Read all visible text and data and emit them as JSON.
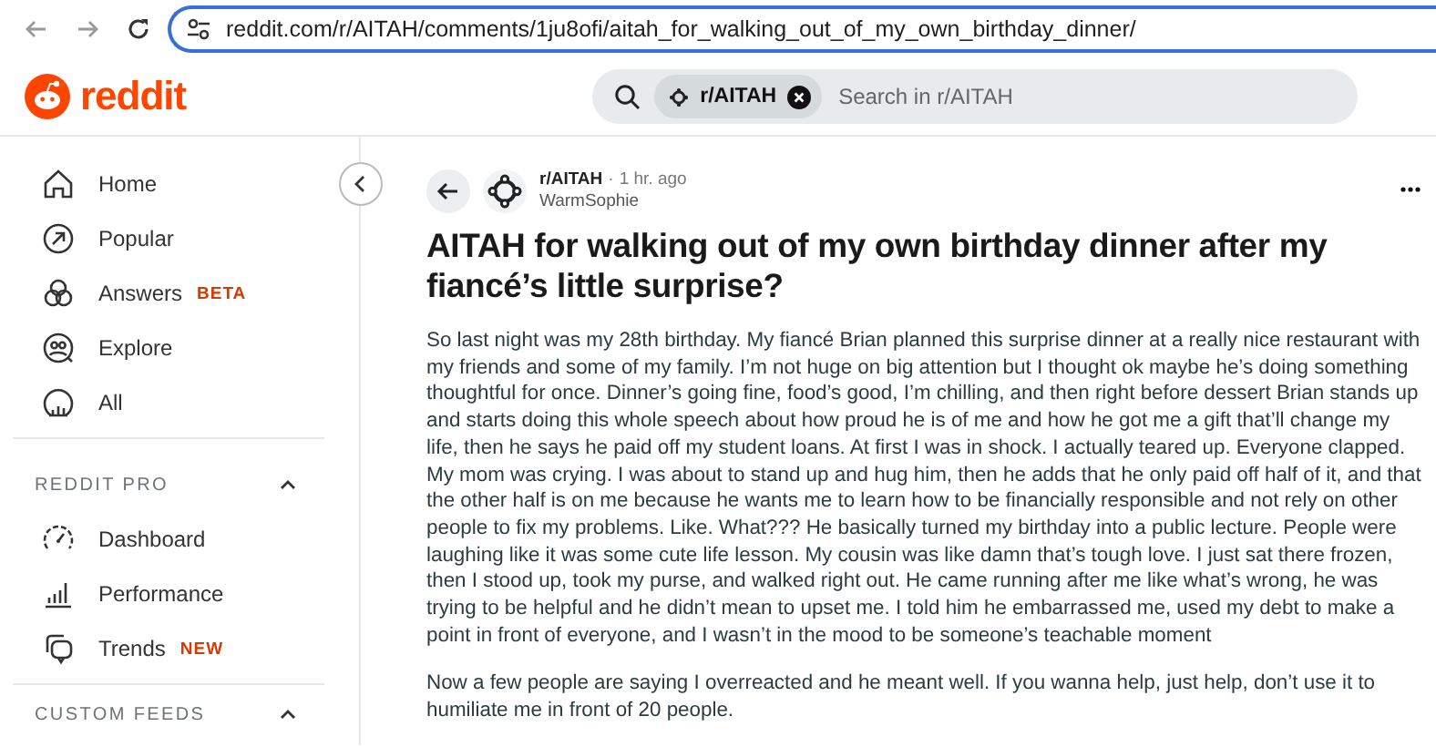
{
  "browser": {
    "url": "reddit.com/r/AITAH/comments/1ju8ofi/aitah_for_walking_out_of_my_own_birthday_dinner/"
  },
  "header": {
    "logo_text": "reddit",
    "search": {
      "chip": "r/AITAH",
      "placeholder": "Search in r/AITAH"
    }
  },
  "sidebar": {
    "items": [
      {
        "label": "Home"
      },
      {
        "label": "Popular"
      },
      {
        "label": "Answers",
        "badge": "BETA"
      },
      {
        "label": "Explore"
      },
      {
        "label": "All"
      }
    ],
    "sections": [
      {
        "title": "REDDIT PRO",
        "expanded": true,
        "items": [
          {
            "label": "Dashboard"
          },
          {
            "label": "Performance"
          },
          {
            "label": "Trends",
            "badge": "NEW"
          }
        ]
      },
      {
        "title": "CUSTOM FEEDS",
        "expanded": true
      }
    ]
  },
  "post": {
    "subreddit": "r/AITAH",
    "separator": "·",
    "time": "1 hr. ago",
    "author": "WarmSophie",
    "title": "AITAH for walking out of my own birthday dinner after my fiancé’s little surprise?",
    "paragraphs": [
      "So last night was my 28th birthday. My fiancé Brian planned this surprise dinner at a really nice restaurant with my friends and some of my family. I’m not huge on big attention but I thought ok maybe he’s doing something thoughtful for once. Dinner’s going fine, food’s good, I’m chilling, and then right before dessert Brian stands up and starts doing this whole speech about how proud he is of me and how he got me a gift that’ll change my life, then he says he paid off my student loans. At first I was in shock. I actually teared up. Everyone clapped. My mom was crying. I was about to stand up and hug him, then he adds that he only paid off half of it, and that the other half is on me because he wants me to learn how to be financially responsible and not rely on other people to fix my problems. Like. What??? He basically turned my birthday into a public lecture. People were laughing like it was some cute life lesson. My cousin was like damn that’s tough love. I just sat there frozen, then I stood up, took my purse, and walked right out. He came running after me like what’s wrong, he was trying to be helpful and he didn’t mean to upset me. I told him he embarrassed me, used my debt to make a point in front of everyone, and I wasn’t in the mood to be someone’s teachable moment",
      "Now a few people are saying I overreacted and he meant well. If you wanna help, just help, don’t use it to humiliate me in front of 20 people."
    ]
  }
}
